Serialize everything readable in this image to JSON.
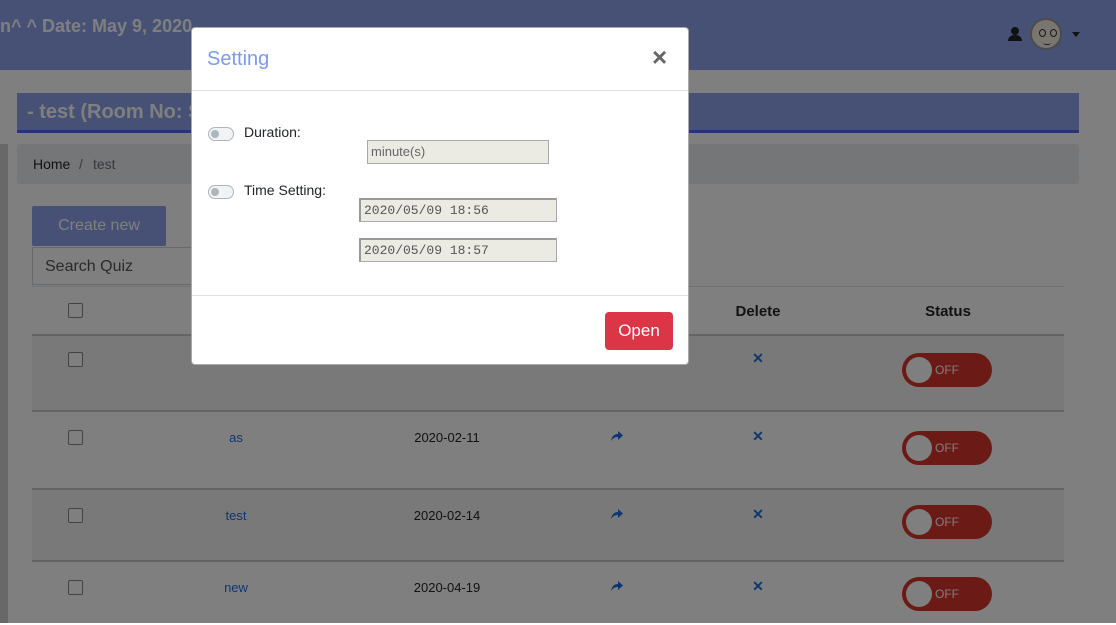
{
  "header": {
    "title": "n^ ^ Date: May 9, 2020"
  },
  "room": {
    "title": "- test (Room No: S"
  },
  "breadcrumb": {
    "home": "Home",
    "separator": "/",
    "current": "test"
  },
  "toolbar": {
    "create_label": "Create new",
    "search_placeholder": "Search Quiz"
  },
  "table": {
    "headers": {
      "delete": "Delete",
      "status": "Status"
    },
    "rows": [
      {
        "name": "",
        "date": "",
        "status": "OFF"
      },
      {
        "name": "as",
        "date": "2020-02-11",
        "status": "OFF"
      },
      {
        "name": "test",
        "date": "2020-02-14",
        "status": "OFF"
      },
      {
        "name": "new",
        "date": "2020-04-19",
        "status": "OFF"
      }
    ]
  },
  "modal": {
    "title": "Setting",
    "close_symbol": "×",
    "duration_label": "Duration:",
    "duration_placeholder": "minute(s)",
    "time_setting_label": "Time Setting:",
    "start_time": "2020/05/09 18:56",
    "end_time": "2020/05/09 18:57",
    "open_label": "Open"
  },
  "colors": {
    "accent": "#8fa3ea",
    "danger": "#dc3545",
    "link": "#1a6fe0"
  },
  "icons": {
    "user": "user-icon",
    "share": "share-icon",
    "delete": "close-icon"
  }
}
